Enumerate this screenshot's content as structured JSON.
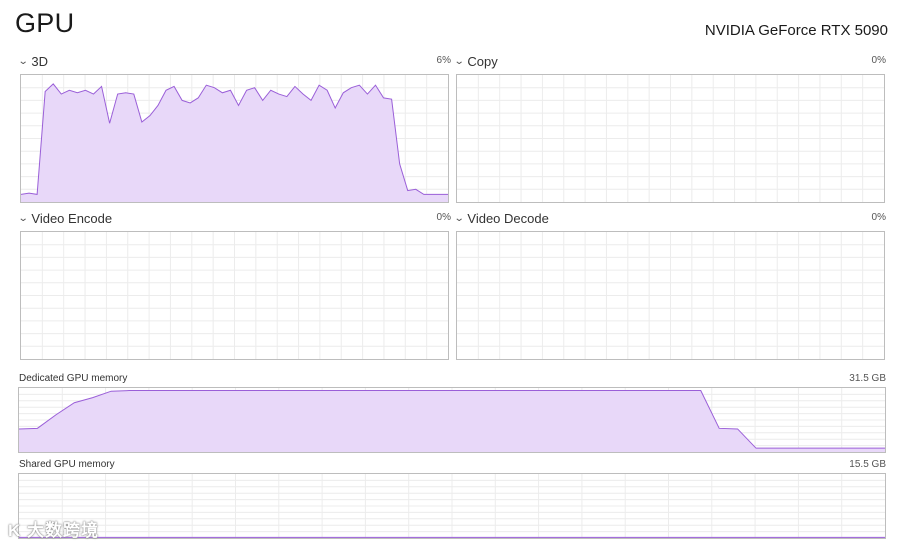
{
  "header": {
    "title": "GPU",
    "gpu_name": "NVIDIA GeForce RTX 5090"
  },
  "panels": [
    {
      "label": "3D",
      "value": "6%",
      "usage_fraction": [
        0.06,
        0.07,
        0.06,
        0.87,
        0.93,
        0.85,
        0.88,
        0.86,
        0.88,
        0.85,
        0.91,
        0.62,
        0.85,
        0.86,
        0.85,
        0.63,
        0.68,
        0.76,
        0.88,
        0.91,
        0.8,
        0.78,
        0.82,
        0.92,
        0.9,
        0.86,
        0.88,
        0.76,
        0.88,
        0.9,
        0.8,
        0.88,
        0.85,
        0.83,
        0.91,
        0.85,
        0.8,
        0.92,
        0.88,
        0.74,
        0.86,
        0.9,
        0.92,
        0.85,
        0.92,
        0.82,
        0.81,
        0.3,
        0.09,
        0.1,
        0.06,
        0.06,
        0.06,
        0.06
      ]
    },
    {
      "label": "Copy",
      "value": "0%",
      "usage_fraction": []
    },
    {
      "label": "Video Encode",
      "value": "0%",
      "usage_fraction": []
    },
    {
      "label": "Video Decode",
      "value": "0%",
      "usage_fraction": []
    }
  ],
  "memory": [
    {
      "label": "Dedicated GPU memory",
      "value": "31.5 GB",
      "usage_fraction": [
        0.36,
        0.37,
        0.58,
        0.77,
        0.85,
        0.95,
        0.96,
        0.96,
        0.96,
        0.96,
        0.96,
        0.96,
        0.96,
        0.96,
        0.96,
        0.96,
        0.96,
        0.96,
        0.96,
        0.96,
        0.96,
        0.96,
        0.96,
        0.96,
        0.96,
        0.96,
        0.96,
        0.96,
        0.96,
        0.96,
        0.96,
        0.96,
        0.96,
        0.96,
        0.96,
        0.96,
        0.96,
        0.96,
        0.37,
        0.36,
        0.06,
        0.06,
        0.06,
        0.06,
        0.06,
        0.06,
        0.06,
        0.06
      ]
    },
    {
      "label": "Shared GPU memory",
      "value": "15.5 GB",
      "usage_fraction": [
        0.01,
        0.01
      ]
    }
  ],
  "watermark": "K 大数跨境",
  "colors": {
    "fill": "#e8d8f9",
    "stroke": "#9a5fd8",
    "grid": "#ececec",
    "border": "#bdbdbd"
  }
}
